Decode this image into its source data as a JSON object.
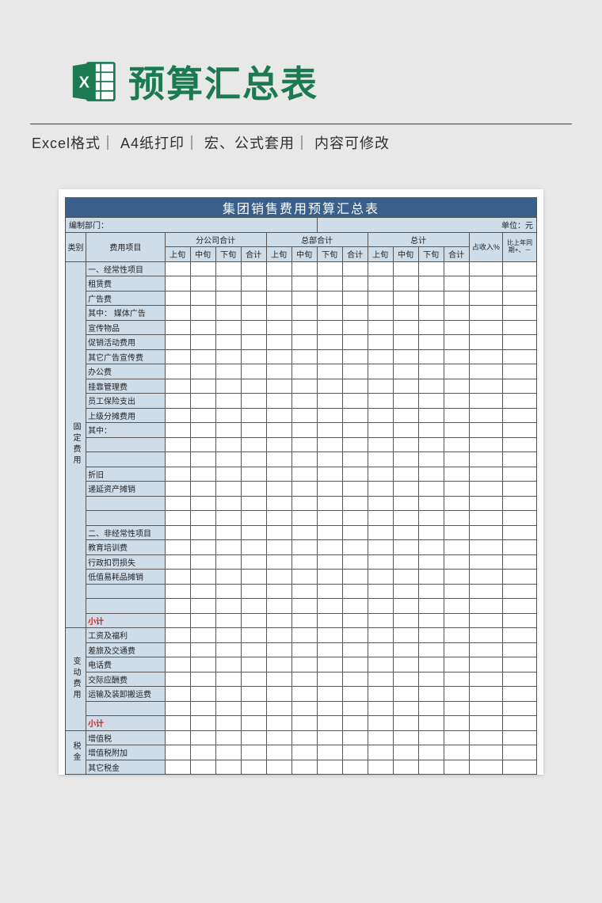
{
  "page": {
    "title": "预算汇总表",
    "meta": "Excel格式｜ A4纸打印｜ 宏、公式套用｜ 内容可修改"
  },
  "sheet": {
    "title": "集团销售费用预算汇总表",
    "dept_label": "编制部门：",
    "unit_label": "单位：元",
    "headers": {
      "category": "类别",
      "item": "费用项目",
      "group1": "分公司合计",
      "group2": "总部合计",
      "group3": "总计",
      "sub": [
        "上旬",
        "中旬",
        "下旬",
        "合计"
      ],
      "ratio": "占收入%",
      "yoy": "比上年同期+、－"
    },
    "sections": [
      {
        "category": "固定费用",
        "span": 25,
        "items": [
          "一、经常性项目",
          "租赁费",
          "广告费",
          "其中：    媒体广告",
          "            宣传物品",
          "            促销活动费用",
          "            其它广告宣传费",
          "办公费",
          "挂靠管理费",
          "员工保险支出",
          "上级分摊费用",
          "其中：",
          "",
          "",
          "折旧",
          "递延资产摊销",
          "",
          "",
          "二、非经常性项目",
          "教育培训费",
          "行政扣罚损失",
          "低值易耗品摊销",
          "",
          "",
          "小计"
        ]
      },
      {
        "category": "变动费用",
        "span": 7,
        "items": [
          "工资及福利",
          "差旅及交通费",
          "电话费",
          "交际应酬费",
          "运输及装卸搬运费",
          "",
          "小计"
        ]
      },
      {
        "category": "税金",
        "span": 3,
        "items": [
          "增值税",
          "增值税附加",
          "其它税金"
        ]
      }
    ]
  }
}
